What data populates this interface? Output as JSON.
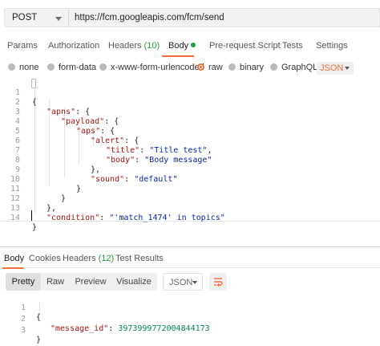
{
  "request": {
    "method": "POST",
    "url": "https://fcm.googleapis.com/fcm/send"
  },
  "request_tabs": [
    {
      "label": "Params"
    },
    {
      "label": "Authorization"
    },
    {
      "label": "Headers",
      "count": "(10)"
    },
    {
      "label": "Body",
      "active": true,
      "status_dot": true
    },
    {
      "label": "Pre-request Script"
    },
    {
      "label": "Tests"
    },
    {
      "label": "Settings"
    }
  ],
  "body_options": {
    "items": [
      {
        "label": "none"
      },
      {
        "label": "form-data"
      },
      {
        "label": "x-www-form-urlencoded"
      },
      {
        "label": "raw",
        "checked": true
      },
      {
        "label": "binary"
      },
      {
        "label": "GraphQL"
      }
    ],
    "format": "JSON"
  },
  "request_body": {
    "line_numbers": [
      "1",
      "2",
      "3",
      "4",
      "5",
      "6",
      "7",
      "8",
      "9",
      "10",
      "11",
      "12",
      "13",
      "14"
    ],
    "lines": {
      "l1": {
        "punct": "{"
      },
      "l2": {
        "key": "\"apns\"",
        "punct": ": {"
      },
      "l3": {
        "key": "\"payload\"",
        "punct": ": {"
      },
      "l4": {
        "key": "\"aps\"",
        "punct": ": {"
      },
      "l5": {
        "key": "\"alert\"",
        "punct": ": {"
      },
      "l6": {
        "key": "\"title\"",
        "sep": ": ",
        "value": "\"Title test\"",
        "trail": ","
      },
      "l7": {
        "key": "\"body\"",
        "sep": ": ",
        "value": "\"Body message\""
      },
      "l8": {
        "punct": "},"
      },
      "l9": {
        "key": "\"sound\"",
        "sep": ": ",
        "value": "\"default\""
      },
      "l10": {
        "punct": "}"
      },
      "l11": {
        "punct": "}"
      },
      "l12": {
        "punct": "},"
      },
      "l13": {
        "key": "\"condition\"",
        "sep": ": ",
        "value": "\"'match_1474' in topics\""
      },
      "l14": {
        "punct": "}"
      }
    }
  },
  "response_tabs": [
    {
      "label": "Body",
      "active": true
    },
    {
      "label": "Cookies"
    },
    {
      "label": "Headers",
      "count": "(12)"
    },
    {
      "label": "Test Results"
    }
  ],
  "response_toolbar": {
    "views": [
      "Pretty",
      "Raw",
      "Preview",
      "Visualize"
    ],
    "active_view": "Pretty",
    "format": "JSON",
    "wrap_icon": "wrap-lines-icon"
  },
  "response_body": {
    "line_numbers": [
      "1",
      "2",
      "3"
    ],
    "open": "{",
    "key": "\"message_id\"",
    "sep": ": ",
    "value": "3973999772004844173",
    "close": "}"
  },
  "colors": {
    "accent": "#f26b3a",
    "count_green": "#23a03a",
    "json_key": "#a31515",
    "json_string": "#0a24a6",
    "json_number": "#098658"
  }
}
